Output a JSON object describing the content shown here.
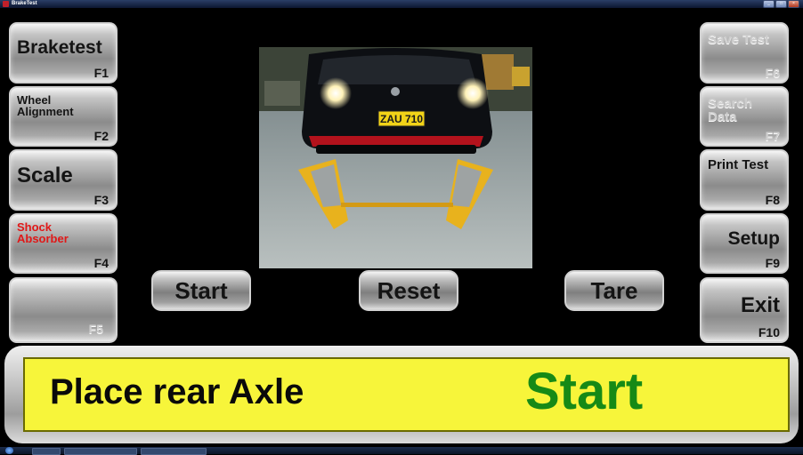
{
  "window": {
    "title": "BrakeTest"
  },
  "left_buttons": [
    {
      "label": "Braketest",
      "key": "F1"
    },
    {
      "label": "Wheel Alignment",
      "key": "F2"
    },
    {
      "label": "Scale",
      "key": "F3"
    },
    {
      "label": "Shock Absorber",
      "key": "F4"
    },
    {
      "label": "",
      "key": "F5"
    }
  ],
  "right_buttons": [
    {
      "label": "Save Test",
      "key": "F6"
    },
    {
      "label": "Search Data",
      "key": "F7"
    },
    {
      "label": "Print Test",
      "key": "F8"
    },
    {
      "label": "Setup",
      "key": "F9"
    },
    {
      "label": "Exit",
      "key": "F10"
    }
  ],
  "controls": {
    "start": "Start",
    "reset": "Reset",
    "tare": "Tare"
  },
  "camera": {
    "plate": "ZAU 710"
  },
  "status": {
    "message": "Place rear Axle",
    "action": "Start",
    "panel_color": "#f7f53a",
    "action_color": "#168a16"
  },
  "colors": {
    "highlight_red": "#e01818",
    "background": "#000000"
  }
}
